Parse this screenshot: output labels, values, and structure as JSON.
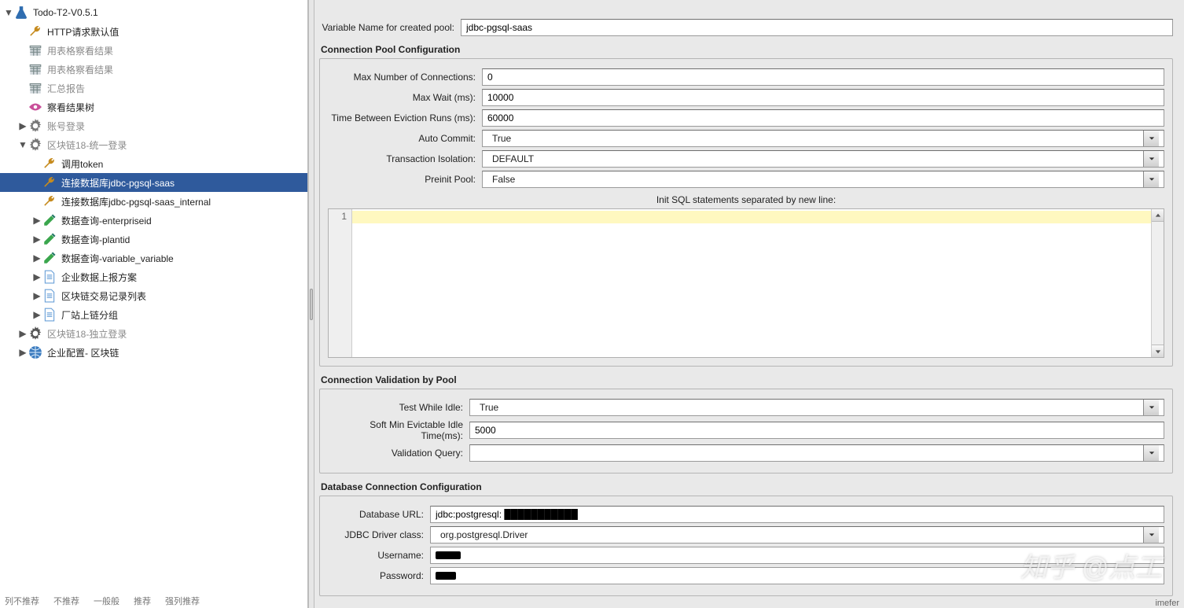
{
  "tree": {
    "root": "Todo-T2-V0.5.1",
    "items": [
      {
        "label": "HTTP请求默认值",
        "icon": "wrench",
        "indent": 1
      },
      {
        "label": "用表格察看结果",
        "icon": "table",
        "indent": 1,
        "dim": true
      },
      {
        "label": "用表格察看结果",
        "icon": "table",
        "indent": 1,
        "dim": true
      },
      {
        "label": "汇总报告",
        "icon": "table",
        "indent": 1,
        "dim": true
      },
      {
        "label": "察看结果树",
        "icon": "eye",
        "indent": 1
      },
      {
        "label": "账号登录",
        "icon": "gear",
        "indent": 1,
        "disc": "▶",
        "dim": true
      },
      {
        "label": "区块链18-统一登录",
        "icon": "gear",
        "indent": 1,
        "disc": "▼",
        "dim": true
      },
      {
        "label": "调用token",
        "icon": "wrench",
        "indent": 2
      },
      {
        "label": "连接数据库jdbc-pgsql-saas",
        "icon": "wrench",
        "indent": 2,
        "selected": true
      },
      {
        "label": "连接数据库jdbc-pgsql-saas_internal",
        "icon": "wrench",
        "indent": 2
      },
      {
        "label": "数据查询-enterpriseid",
        "icon": "pencil",
        "indent": 2,
        "disc": "▶"
      },
      {
        "label": "数据查询-plantid",
        "icon": "pencil",
        "indent": 2,
        "disc": "▶"
      },
      {
        "label": "数据查询-variable_variable",
        "icon": "pencil",
        "indent": 2,
        "disc": "▶"
      },
      {
        "label": "企业数据上报方案",
        "icon": "doc",
        "indent": 2,
        "disc": "▶"
      },
      {
        "label": "区块链交易记录列表",
        "icon": "doc",
        "indent": 2,
        "disc": "▶"
      },
      {
        "label": "厂站上链分组",
        "icon": "doc",
        "indent": 2,
        "disc": "▶"
      },
      {
        "label": "区块链18-独立登录",
        "icon": "gear-dk",
        "indent": 1,
        "disc": "▶",
        "dim": true
      },
      {
        "label": "企业配置- 区块链",
        "icon": "globe",
        "indent": 1,
        "disc": "▶"
      }
    ]
  },
  "varNameLabel": "Variable Name for created pool:",
  "varNameValue": "jdbc-pgsql-saas",
  "sections": {
    "pool": "Connection Pool Configuration",
    "validation": "Connection Validation by Pool",
    "db": "Database Connection Configuration"
  },
  "pool": {
    "maxConnLabel": "Max Number of Connections:",
    "maxConnValue": "0",
    "maxWaitLabel": "Max Wait (ms):",
    "maxWaitValue": "10000",
    "evictLabel": "Time Between Eviction Runs (ms):",
    "evictValue": "60000",
    "autoCommitLabel": "Auto Commit:",
    "autoCommitValue": "True",
    "isoLabel": "Transaction Isolation:",
    "isoValue": "DEFAULT",
    "preinitLabel": "Preinit Pool:",
    "preinitValue": "False",
    "initSqlLabel": "Init SQL statements separated by new line:",
    "gutterLine": "1"
  },
  "validation": {
    "testIdleLabel": "Test While Idle:",
    "testIdleValue": "True",
    "softMinLabel": "Soft Min Evictable Idle Time(ms):",
    "softMinValue": "5000",
    "valQueryLabel": "Validation Query:",
    "valQueryValue": ""
  },
  "db": {
    "urlLabel": "Database URL:",
    "urlValue": "jdbc:postgresql:",
    "driverLabel": "JDBC Driver class:",
    "driverValue": "org.postgresql.Driver",
    "userLabel": "Username:",
    "passLabel": "Password:"
  },
  "watermark": "知乎 @点工",
  "footer": [
    "列不推荐",
    "不推荐",
    "一般般",
    "推荐",
    "强列推荐"
  ],
  "smalltext": "imefer"
}
